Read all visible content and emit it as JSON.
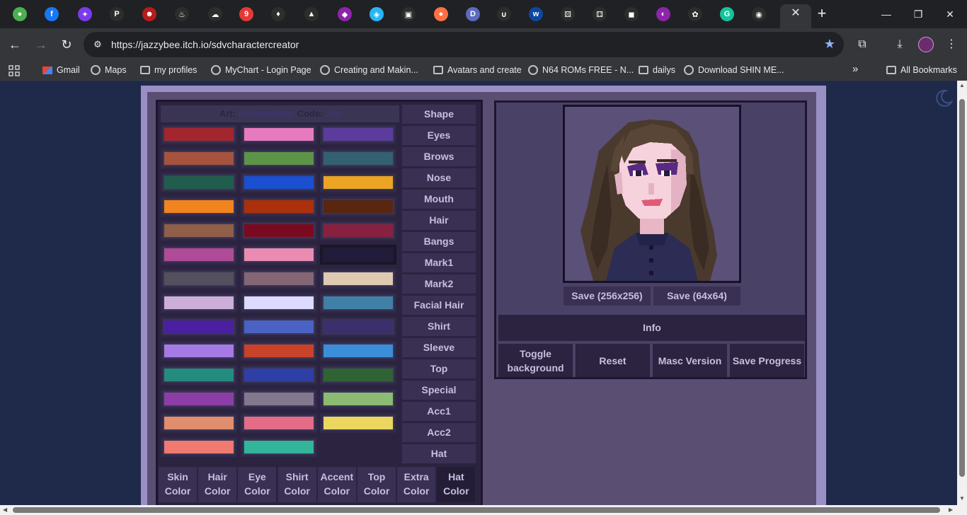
{
  "browser": {
    "tabs": [
      {
        "icon": "globe-icon",
        "color": "#4caf50",
        "glyph": "●"
      },
      {
        "icon": "facebook-icon",
        "color": "#1877f2",
        "glyph": "f"
      },
      {
        "icon": "star-app-icon",
        "color": "#7c3aed",
        "glyph": "✦"
      },
      {
        "icon": "p-app-icon",
        "color": "#2d2d2d",
        "glyph": "P"
      },
      {
        "icon": "ninja-icon",
        "color": "#b71c1c",
        "glyph": "☻"
      },
      {
        "icon": "flame-icon",
        "color": "#2d2d2d",
        "glyph": "♨"
      },
      {
        "icon": "ghost-icon",
        "color": "#2d2d2d",
        "glyph": "☁"
      },
      {
        "icon": "badge-icon",
        "color": "#e53935",
        "glyph": "9"
      },
      {
        "icon": "swan-icon",
        "color": "#2d2d2d",
        "glyph": "♦"
      },
      {
        "icon": "triangle-icon",
        "color": "#2d2d2d",
        "glyph": "▲"
      },
      {
        "icon": "gradient-app-icon",
        "color": "#8e24aa",
        "glyph": "◆"
      },
      {
        "icon": "cube-icon",
        "color": "#29b6f6",
        "glyph": "◈"
      },
      {
        "icon": "chat-icon",
        "color": "#2d2d2d",
        "glyph": "▣"
      },
      {
        "icon": "orange-app-icon",
        "color": "#ff7043",
        "glyph": "●"
      },
      {
        "icon": "d-app-icon",
        "color": "#5c6bc0",
        "glyph": "D"
      },
      {
        "icon": "hook-icon",
        "color": "#2d2d2d",
        "glyph": "∪"
      },
      {
        "icon": "w-app-icon",
        "color": "#0d47a1",
        "glyph": "w"
      },
      {
        "icon": "dice-icon",
        "color": "#2d2d2d",
        "glyph": "⚄"
      },
      {
        "icon": "dice-icon",
        "color": "#2d2d2d",
        "glyph": "⚃"
      },
      {
        "icon": "roblox-icon",
        "color": "#2d2d2d",
        "glyph": "◼"
      },
      {
        "icon": "pokeball-icon",
        "color": "#8e24aa",
        "glyph": "◐"
      },
      {
        "icon": "chatgpt-icon",
        "color": "#2d2d2d",
        "glyph": "✿"
      },
      {
        "icon": "grammarly-icon",
        "color": "#15c39a",
        "glyph": "G"
      },
      {
        "icon": "shield-mask-icon",
        "color": "#2d2d2d",
        "glyph": "◉"
      }
    ],
    "active_tab_close": "✕",
    "new_tab": "+",
    "url": "https://jazzybee.itch.io/sdvcharactercreator",
    "bookmarks": [
      {
        "label": "Gmail",
        "icon": "gmail-icon"
      },
      {
        "label": "Maps",
        "icon": "globe-icon"
      },
      {
        "label": "my profiles",
        "icon": "folder-icon"
      },
      {
        "label": "MyChart - Login Page",
        "icon": "globe-icon"
      },
      {
        "label": "Creating and Makin...",
        "icon": "globe-icon"
      },
      {
        "label": "Avatars and create",
        "icon": "folder-icon"
      },
      {
        "label": "N64 ROMs FREE - N...",
        "icon": "globe-icon"
      },
      {
        "label": "dailys",
        "icon": "folder-icon"
      },
      {
        "label": "Download SHIN ME...",
        "icon": "globe-icon"
      }
    ],
    "more_bookmarks": "»",
    "all_bookmarks": "All Bookmarks"
  },
  "creator": {
    "credit": {
      "art_label": "Art:",
      "art_name": "Poltergeister",
      "code_label": "Code:",
      "code_name": "Jaz"
    },
    "swatches": [
      "#a3262f",
      "#e77bbf",
      "#5b3c9c",
      "#a6533d",
      "#5e9448",
      "#336171",
      "#215d4c",
      "#1a4fcf",
      "#eba522",
      "#f28420",
      "#ab300b",
      "#59260f",
      "#8f5f49",
      "#7a0a1f",
      "#87213f",
      "#b04b98",
      "#ea8cb1",
      "#211c39",
      "#54505e",
      "#846674",
      "#decab1",
      "#ccaedb",
      "#dcdaff",
      "#4180a6",
      "#4a1fa0",
      "#4962c4",
      "#3b2f6d",
      "#a57ae5",
      "#c9432a",
      "#3b8fd9",
      "#248c7e",
      "#2e3fa6",
      "#2f6333",
      "#8d3ea6",
      "#84788f",
      "#8cbb73",
      "#e08e6e",
      "#e46c87",
      "#ebd660",
      "#f07a70",
      "#33b59b"
    ],
    "selected_swatch": 17,
    "categories": [
      "Shape",
      "Eyes",
      "Brows",
      "Nose",
      "Mouth",
      "Hair",
      "Bangs",
      "Mark1",
      "Mark2",
      "Facial Hair",
      "Shirt",
      "Sleeve",
      "Top",
      "Special",
      "Acc1",
      "Acc2",
      "Hat"
    ],
    "color_tabs": [
      {
        "line1": "Skin",
        "line2": "Color"
      },
      {
        "line1": "Hair",
        "line2": "Color"
      },
      {
        "line1": "Eye",
        "line2": "Color"
      },
      {
        "line1": "Shirt",
        "line2": "Color"
      },
      {
        "line1": "Accent",
        "line2": "Color"
      },
      {
        "line1": "Top",
        "line2": "Color"
      },
      {
        "line1": "Extra",
        "line2": "Color"
      },
      {
        "line1": "Hat",
        "line2": "Color"
      }
    ],
    "active_color_tab": 7,
    "save_256": "Save (256x256)",
    "save_64": "Save (64x64)",
    "info": "Info",
    "actions": [
      {
        "line1": "Toggle",
        "line2": "background"
      },
      {
        "line1": "Reset",
        "line2": ""
      },
      {
        "line1": "Masc Version",
        "line2": ""
      },
      {
        "line1": "Save Progress",
        "line2": ""
      }
    ]
  }
}
